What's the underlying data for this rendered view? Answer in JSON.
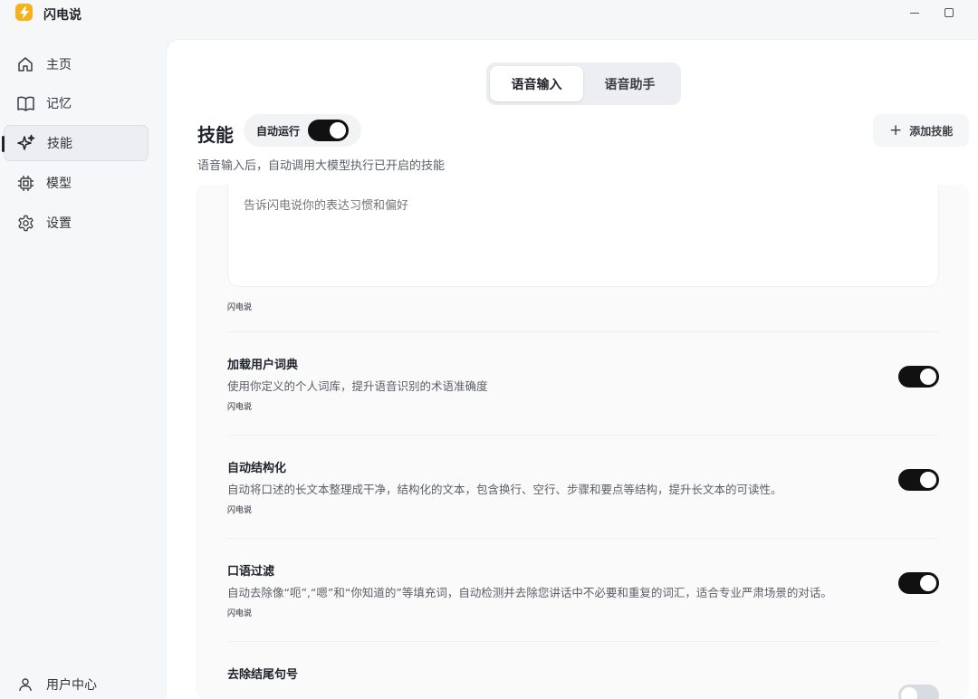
{
  "app": {
    "title": "闪电说"
  },
  "sidebar": {
    "items": [
      {
        "label": "主页",
        "icon": "home-icon"
      },
      {
        "label": "记忆",
        "icon": "book-icon"
      },
      {
        "label": "技能",
        "icon": "sparkles-icon",
        "active": true
      },
      {
        "label": "模型",
        "icon": "chip-icon"
      },
      {
        "label": "设置",
        "icon": "gear-icon"
      }
    ],
    "user_center": "用户中心"
  },
  "tabs": [
    {
      "label": "语音输入",
      "active": true
    },
    {
      "label": "语音助手",
      "active": false
    }
  ],
  "skills": {
    "title": "技能",
    "auto_run_label": "自动运行",
    "auto_run_on": true,
    "add_label": "添加技能",
    "description": "语音输入后，自动调用大模型执行已开启的技能"
  },
  "preference": {
    "placeholder": "告诉闪电说你的表达习惯和偏好",
    "source": "闪电说"
  },
  "skill_items": [
    {
      "title": "加载用户词典",
      "desc": "使用你定义的个人词库，提升语音识别的术语准确度",
      "source": "闪电说",
      "enabled": true
    },
    {
      "title": "自动结构化",
      "desc": "自动将口述的长文本整理成干净，结构化的文本，包含换行、空行、步骤和要点等结构，提升长文本的可读性。",
      "source": "闪电说",
      "enabled": true
    },
    {
      "title": "口语过滤",
      "desc": "自动去除像“呃”,“嗯”和“你知道的”等填充词，自动检测并去除您讲话中不必要和重复的词汇，适合专业严肃场景的对话。",
      "source": "闪电说",
      "enabled": true
    },
    {
      "title": "去除结尾句号",
      "desc": "",
      "source": "",
      "enabled": false
    }
  ],
  "colors": {
    "accent": "#111111",
    "logo": "#f5b21b"
  }
}
